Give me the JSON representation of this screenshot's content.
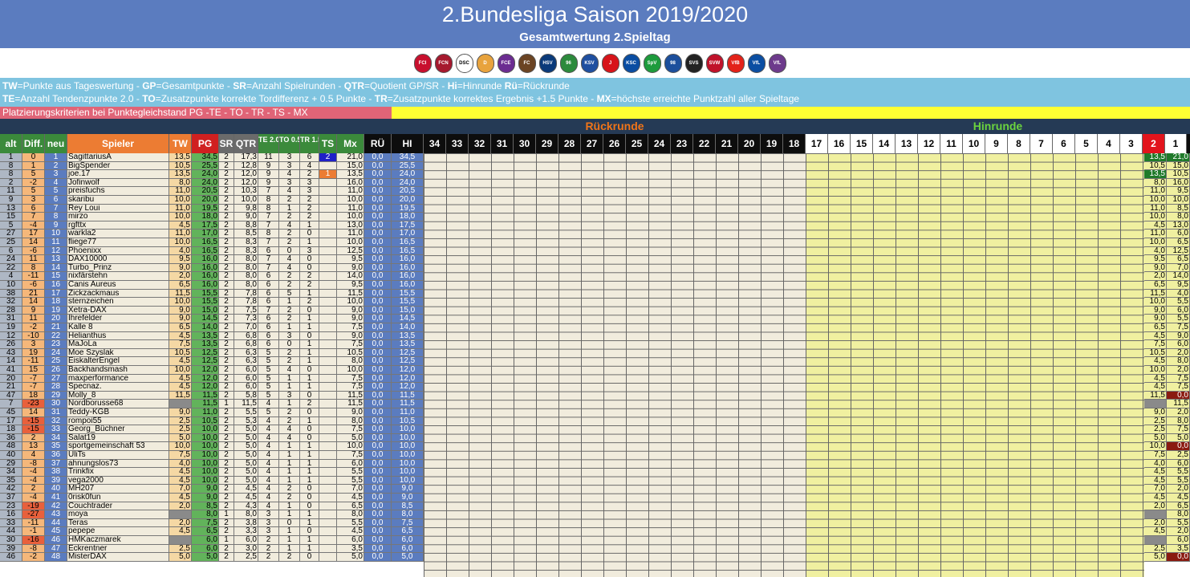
{
  "header": {
    "title": "2.Bundesliga Saison 2019/2020",
    "subtitle": "Gesamtwertung 2.Spieltag"
  },
  "logos": [
    {
      "name": "fc-ingolstadt-logo",
      "color": "#c8102e",
      "text": "FCI"
    },
    {
      "name": "1-fc-nuernberg-logo",
      "color": "#a6192e",
      "text": "FCN"
    },
    {
      "name": "arminia-bielefeld-logo",
      "color": "#ffffff",
      "text": "DSC"
    },
    {
      "name": "dynamo-dresden-logo",
      "color": "#e8a33d",
      "text": "D"
    },
    {
      "name": "erzgebirge-aue-logo",
      "color": "#6b2c91",
      "text": "FCE"
    },
    {
      "name": "st-pauli-logo",
      "color": "#6b4423",
      "text": "FC"
    },
    {
      "name": "hamburger-sv-logo",
      "color": "#0a3a7a",
      "text": "HSV"
    },
    {
      "name": "hannover-96-logo",
      "color": "#2c8a3c",
      "text": "96"
    },
    {
      "name": "holstein-kiel-logo",
      "color": "#1f4fa0",
      "text": "KSV"
    },
    {
      "name": "jahn-regensburg-logo",
      "color": "#d7141a",
      "text": "J"
    },
    {
      "name": "karlsruher-sc-logo",
      "color": "#0a4da2",
      "text": "KSC"
    },
    {
      "name": "greuther-fuerth-logo",
      "color": "#1d9b3c",
      "text": "SpV"
    },
    {
      "name": "darmstadt-98-logo",
      "color": "#1c4f9c",
      "text": "98"
    },
    {
      "name": "sandhausen-logo",
      "color": "#222222",
      "text": "SVS"
    },
    {
      "name": "wehen-wiesbaden-logo",
      "color": "#c0122a",
      "text": "SVW"
    },
    {
      "name": "vfb-stuttgart-logo",
      "color": "#e32219",
      "text": "VfB"
    },
    {
      "name": "vfl-bochum-logo",
      "color": "#0b4ea2",
      "text": "VfL"
    },
    {
      "name": "vfl-osnabrueck-logo",
      "color": "#6d3a8c",
      "text": "VfL"
    }
  ],
  "legend": {
    "line1": [
      {
        "k": "TW",
        "v": "=Punkte aus Tageswertung - "
      },
      {
        "k": "GP",
        "v": "=Gesamtpunkte - "
      },
      {
        "k": "SR",
        "v": "=Anzahl Spielrunden - "
      },
      {
        "k": "QTR",
        "v": "=Quotient GP/SR - "
      },
      {
        "k": "Hi",
        "v": "=Hinrunde "
      },
      {
        "k": "Rü",
        "v": "=Rückrunde"
      }
    ],
    "line2": [
      {
        "k": "TE",
        "v": "=Anzahl Tendenzpunkte 2.0 - "
      },
      {
        "k": "TO",
        "v": "=Zusatzpunkte korrekte Tordifferenz + 0.5 Punkte - "
      },
      {
        "k": "TR",
        "v": "=Zusatzpunkte korrektes Ergebnis +1.5 Punkte - "
      },
      {
        "k": "MX",
        "v": "=höchste erreichte Punktzahl aller Spieltage"
      }
    ]
  },
  "criteria": "Platzierungskriterien bei Punktegleichstand  PG  -TE - TO - TR - TS - MX",
  "rounds": {
    "rueck_label": "Rückrunde",
    "hin_label": "Hinrunde"
  },
  "columns": {
    "alt": "alt",
    "diff": "Diff.",
    "neu": "neu",
    "spieler": "Spieler",
    "tw": "TW",
    "pg": "PG",
    "sr": "SR",
    "qtr": "QTR",
    "te": "TE 2.0",
    "to": "TO 0.5",
    "tr": "TR 1.5",
    "ts": "TS",
    "mx": "Mx",
    "ru": "RÜ",
    "hi": "HI",
    "rueck_days": [
      "34",
      "33",
      "32",
      "31",
      "30",
      "29",
      "28",
      "27",
      "26",
      "25",
      "24",
      "23",
      "22",
      "21",
      "20",
      "19",
      "18"
    ],
    "hin_days": [
      "17",
      "16",
      "15",
      "14",
      "13",
      "12",
      "11",
      "10",
      "9",
      "8",
      "7",
      "6",
      "5",
      "4",
      "3",
      "2",
      "1"
    ]
  },
  "rows": [
    [
      "1",
      "0",
      "1",
      "SagittariusA",
      "13,5",
      "34,5",
      "2",
      "17,3",
      "11",
      "3",
      "6",
      "2",
      "21,0",
      "0,0",
      "34,5",
      "13,5",
      "21,0"
    ],
    [
      "8",
      "1",
      "2",
      "BigSpender",
      "10,5",
      "25,5",
      "2",
      "12,8",
      "9",
      "3",
      "4",
      "",
      "15,0",
      "0,0",
      "25,5",
      "10,5",
      "15,0"
    ],
    [
      "8",
      "5",
      "3",
      "joe.17",
      "13,5",
      "24,0",
      "2",
      "12,0",
      "9",
      "4",
      "2",
      "1",
      "13,5",
      "0,0",
      "24,0",
      "13,5",
      "10,5"
    ],
    [
      "2",
      "-2",
      "4",
      "Jofinwolf",
      "8,0",
      "24,0",
      "2",
      "12,0",
      "9",
      "3",
      "3",
      "",
      "16,0",
      "0,0",
      "24,0",
      "8,0",
      "16,0"
    ],
    [
      "11",
      "5",
      "5",
      "preisfuchs",
      "11,0",
      "20,5",
      "2",
      "10,3",
      "7",
      "4",
      "3",
      "",
      "11,0",
      "0,0",
      "20,5",
      "11,0",
      "9,5"
    ],
    [
      "9",
      "3",
      "6",
      "skaribu",
      "10,0",
      "20,0",
      "2",
      "10,0",
      "8",
      "2",
      "2",
      "",
      "10,0",
      "0,0",
      "20,0",
      "10,0",
      "10,0"
    ],
    [
      "13",
      "6",
      "7",
      "Rey Loui",
      "11,0",
      "19,5",
      "2",
      "9,8",
      "8",
      "1",
      "2",
      "",
      "11,0",
      "0,0",
      "19,5",
      "11,0",
      "8,5"
    ],
    [
      "15",
      "7",
      "8",
      "mirzo",
      "10,0",
      "18,0",
      "2",
      "9,0",
      "7",
      "2",
      "2",
      "",
      "10,0",
      "0,0",
      "18,0",
      "10,0",
      "8,0"
    ],
    [
      "5",
      "-4",
      "9",
      "rgfttx",
      "4,5",
      "17,5",
      "2",
      "8,8",
      "7",
      "4",
      "1",
      "",
      "13,0",
      "0,0",
      "17,5",
      "4,5",
      "13,0"
    ],
    [
      "27",
      "17",
      "10",
      "warkla2",
      "11,0",
      "17,0",
      "2",
      "8,5",
      "8",
      "2",
      "0",
      "",
      "11,0",
      "0,0",
      "17,0",
      "11,0",
      "6,0"
    ],
    [
      "25",
      "14",
      "11",
      "fliege77",
      "10,0",
      "16,5",
      "2",
      "8,3",
      "7",
      "2",
      "1",
      "",
      "10,0",
      "0,0",
      "16,5",
      "10,0",
      "6,5"
    ],
    [
      "6",
      "-6",
      "12",
      "Phoenixx",
      "4,0",
      "16,5",
      "2",
      "8,3",
      "6",
      "0",
      "3",
      "",
      "12,5",
      "0,0",
      "16,5",
      "4,0",
      "12,5"
    ],
    [
      "24",
      "11",
      "13",
      "DAX10000",
      "9,5",
      "16,0",
      "2",
      "8,0",
      "7",
      "4",
      "0",
      "",
      "9,5",
      "0,0",
      "16,0",
      "9,5",
      "6,5"
    ],
    [
      "22",
      "8",
      "14",
      "Turbo_Prinz",
      "9,0",
      "16,0",
      "2",
      "8,0",
      "7",
      "4",
      "0",
      "",
      "9,0",
      "0,0",
      "16,0",
      "9,0",
      "7,0"
    ],
    [
      "4",
      "-11",
      "15",
      "nixfärstehn",
      "2,0",
      "16,0",
      "2",
      "8,0",
      "6",
      "2",
      "2",
      "",
      "14,0",
      "0,0",
      "16,0",
      "2,0",
      "14,0"
    ],
    [
      "10",
      "-6",
      "16",
      "Canis Aureus",
      "6,5",
      "16,0",
      "2",
      "8,0",
      "6",
      "2",
      "2",
      "",
      "9,5",
      "0,0",
      "16,0",
      "6,5",
      "9,5"
    ],
    [
      "38",
      "21",
      "17",
      "Zickzackmaus",
      "11,5",
      "15,5",
      "2",
      "7,8",
      "6",
      "5",
      "1",
      "",
      "11,5",
      "0,0",
      "15,5",
      "11,5",
      "4,0"
    ],
    [
      "32",
      "14",
      "18",
      "sternzeichen",
      "10,0",
      "15,5",
      "2",
      "7,8",
      "6",
      "1",
      "2",
      "",
      "10,0",
      "0,0",
      "15,5",
      "10,0",
      "5,5"
    ],
    [
      "28",
      "9",
      "19",
      "Xetra-DAX",
      "9,0",
      "15,0",
      "2",
      "7,5",
      "7",
      "2",
      "0",
      "",
      "9,0",
      "0,0",
      "15,0",
      "9,0",
      "6,0"
    ],
    [
      "31",
      "11",
      "20",
      "Ihrefelder",
      "9,0",
      "14,5",
      "2",
      "7,3",
      "6",
      "2",
      "1",
      "",
      "9,0",
      "0,0",
      "14,5",
      "9,0",
      "5,5"
    ],
    [
      "19",
      "-2",
      "21",
      "Kalle 8",
      "6,5",
      "14,0",
      "2",
      "7,0",
      "6",
      "1",
      "1",
      "",
      "7,5",
      "0,0",
      "14,0",
      "6,5",
      "7,5"
    ],
    [
      "12",
      "-10",
      "22",
      "Helianthus",
      "4,5",
      "13,5",
      "2",
      "6,8",
      "6",
      "3",
      "0",
      "",
      "9,0",
      "0,0",
      "13,5",
      "4,5",
      "9,0"
    ],
    [
      "26",
      "3",
      "23",
      "MaJoLa",
      "7,5",
      "13,5",
      "2",
      "6,8",
      "6",
      "0",
      "1",
      "",
      "7,5",
      "0,0",
      "13,5",
      "7,5",
      "6,0"
    ],
    [
      "43",
      "19",
      "24",
      "Moe Szyslak",
      "10,5",
      "12,5",
      "2",
      "6,3",
      "5",
      "2",
      "1",
      "",
      "10,5",
      "0,0",
      "12,5",
      "10,5",
      "2,0"
    ],
    [
      "14",
      "-11",
      "25",
      "EiskalterEngel",
      "4,5",
      "12,5",
      "2",
      "6,3",
      "5",
      "2",
      "1",
      "",
      "8,0",
      "0,0",
      "12,5",
      "4,5",
      "8,0"
    ],
    [
      "41",
      "15",
      "26",
      "Backhandsmash",
      "10,0",
      "12,0",
      "2",
      "6,0",
      "5",
      "4",
      "0",
      "",
      "10,0",
      "0,0",
      "12,0",
      "10,0",
      "2,0"
    ],
    [
      "20",
      "-7",
      "27",
      "maxperformance",
      "4,5",
      "12,0",
      "2",
      "6,0",
      "5",
      "1",
      "1",
      "",
      "7,5",
      "0,0",
      "12,0",
      "4,5",
      "7,5"
    ],
    [
      "21",
      "-7",
      "28",
      "Specnaz.",
      "4,5",
      "12,0",
      "2",
      "6,0",
      "5",
      "1",
      "1",
      "",
      "7,5",
      "0,0",
      "12,0",
      "4,5",
      "7,5"
    ],
    [
      "47",
      "18",
      "29",
      "Molly_8",
      "11,5",
      "11,5",
      "2",
      "5,8",
      "5",
      "3",
      "0",
      "",
      "11,5",
      "0,0",
      "11,5",
      "11,5",
      "0,0"
    ],
    [
      "7",
      "-23",
      "30",
      "Nordborusse68",
      "",
      "11,5",
      "1",
      "11,5",
      "4",
      "1",
      "2",
      "",
      "11,5",
      "0,0",
      "11,5",
      "",
      "11,5"
    ],
    [
      "45",
      "14",
      "31",
      "Teddy-KGB",
      "9,0",
      "11,0",
      "2",
      "5,5",
      "5",
      "2",
      "0",
      "",
      "9,0",
      "0,0",
      "11,0",
      "9,0",
      "2,0"
    ],
    [
      "17",
      "-15",
      "32",
      "rompoi55",
      "2,5",
      "10,5",
      "2",
      "5,3",
      "4",
      "2",
      "1",
      "",
      "8,0",
      "0,0",
      "10,5",
      "2,5",
      "8,0"
    ],
    [
      "18",
      "-15",
      "33",
      "Georg_Büchner",
      "2,5",
      "10,0",
      "2",
      "5,0",
      "4",
      "4",
      "0",
      "",
      "7,5",
      "0,0",
      "10,0",
      "2,5",
      "7,5"
    ],
    [
      "36",
      "2",
      "34",
      "Salat19",
      "5,0",
      "10,0",
      "2",
      "5,0",
      "4",
      "4",
      "0",
      "",
      "5,0",
      "0,0",
      "10,0",
      "5,0",
      "5,0"
    ],
    [
      "48",
      "13",
      "35",
      "sportgemeinschaft 53",
      "10,0",
      "10,0",
      "2",
      "5,0",
      "4",
      "1",
      "1",
      "",
      "10,0",
      "0,0",
      "10,0",
      "10,0",
      "0,0"
    ],
    [
      "40",
      "4",
      "36",
      "UliTs",
      "7,5",
      "10,0",
      "2",
      "5,0",
      "4",
      "1",
      "1",
      "",
      "7,5",
      "0,0",
      "10,0",
      "7,5",
      "2,5"
    ],
    [
      "29",
      "-8",
      "37",
      "ahnungslos73",
      "4,0",
      "10,0",
      "2",
      "5,0",
      "4",
      "1",
      "1",
      "",
      "6,0",
      "0,0",
      "10,0",
      "4,0",
      "6,0"
    ],
    [
      "34",
      "-4",
      "38",
      "Trinkfix",
      "4,5",
      "10,0",
      "2",
      "5,0",
      "4",
      "1",
      "1",
      "",
      "5,5",
      "0,0",
      "10,0",
      "4,5",
      "5,5"
    ],
    [
      "35",
      "-4",
      "39",
      "vega2000",
      "4,5",
      "10,0",
      "2",
      "5,0",
      "4",
      "1",
      "1",
      "",
      "5,5",
      "0,0",
      "10,0",
      "4,5",
      "5,5"
    ],
    [
      "42",
      "2",
      "40",
      "MH207",
      "7,0",
      "9,0",
      "2",
      "4,5",
      "4",
      "2",
      "0",
      "",
      "7,0",
      "0,0",
      "9,0",
      "7,0",
      "2,0"
    ],
    [
      "37",
      "-4",
      "41",
      "0risk0fun",
      "4,5",
      "9,0",
      "2",
      "4,5",
      "4",
      "2",
      "0",
      "",
      "4,5",
      "0,0",
      "9,0",
      "4,5",
      "4,5"
    ],
    [
      "23",
      "-19",
      "42",
      "Couchtrader",
      "2,0",
      "8,5",
      "2",
      "4,3",
      "4",
      "1",
      "0",
      "",
      "6,5",
      "0,0",
      "8,5",
      "2,0",
      "6,5"
    ],
    [
      "16",
      "-27",
      "43",
      "moya",
      "",
      "8,0",
      "1",
      "8,0",
      "3",
      "1",
      "1",
      "",
      "8,0",
      "0,0",
      "8,0",
      "",
      "8,0"
    ],
    [
      "33",
      "-11",
      "44",
      "Teras",
      "2,0",
      "7,5",
      "2",
      "3,8",
      "3",
      "0",
      "1",
      "",
      "5,5",
      "0,0",
      "7,5",
      "2,0",
      "5,5"
    ],
    [
      "44",
      "-1",
      "45",
      "pepepe",
      "4,5",
      "6,5",
      "2",
      "3,3",
      "3",
      "1",
      "0",
      "",
      "4,5",
      "0,0",
      "6,5",
      "4,5",
      "2,0"
    ],
    [
      "30",
      "-16",
      "46",
      "HMKaczmarek",
      "",
      "6,0",
      "1",
      "6,0",
      "2",
      "1",
      "1",
      "",
      "6,0",
      "0,0",
      "6,0",
      "",
      "6,0"
    ],
    [
      "39",
      "-8",
      "47",
      "Eckrentner",
      "2,5",
      "6,0",
      "2",
      "3,0",
      "2",
      "1",
      "1",
      "",
      "3,5",
      "0,0",
      "6,0",
      "2,5",
      "3,5"
    ],
    [
      "46",
      "-2",
      "48",
      "MisterDAX",
      "5,0",
      "5,0",
      "2",
      "2,5",
      "2",
      "2",
      "0",
      "",
      "5,0",
      "0,0",
      "5,0",
      "5,0",
      "0,0"
    ]
  ]
}
